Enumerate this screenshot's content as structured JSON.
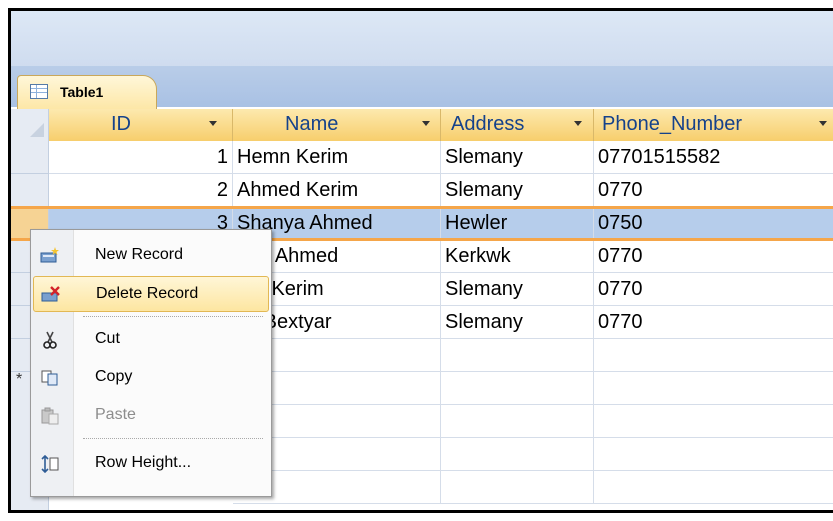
{
  "tab": {
    "label": "Table1",
    "icon": "table-icon"
  },
  "columns": [
    {
      "label": "ID"
    },
    {
      "label": "Name"
    },
    {
      "label": "Address"
    },
    {
      "label": "Phone_Number"
    }
  ],
  "rows": [
    {
      "id": "1",
      "name": "Hemn Kerim",
      "address": "Slemany",
      "phone": "07701515582"
    },
    {
      "id": "2",
      "name": "Ahmed Kerim",
      "address": "Slemany",
      "phone": "0770"
    },
    {
      "id": "3",
      "name": "Shanya Ahmed",
      "address": "Hewler",
      "phone": "0750"
    },
    {
      "id": "",
      "name": "ano Ahmed",
      "address": "Kerkwk",
      "phone": "0770"
    },
    {
      "id": "",
      "name": "ner Kerim",
      "address": "Slemany",
      "phone": "0770"
    },
    {
      "id": "",
      "name": "vo Bextyar",
      "address": "Slemany",
      "phone": "0770"
    }
  ],
  "context_menu": {
    "items": [
      {
        "label": "New Record",
        "icon": "new-record-icon"
      },
      {
        "label": "Delete Record",
        "icon": "delete-record-icon"
      },
      {
        "label": "Cut",
        "icon": "scissors-icon"
      },
      {
        "label": "Copy",
        "icon": "copy-icon"
      },
      {
        "label": "Paste",
        "icon": "paste-icon"
      },
      {
        "label": "Row Height...",
        "icon": "row-height-icon"
      }
    ]
  },
  "colors": {
    "header": "#f7ce6c",
    "selected_row": "#b6cdeb",
    "selection_border": "#f5a64a",
    "tab_strip": "#a9c1e4"
  }
}
